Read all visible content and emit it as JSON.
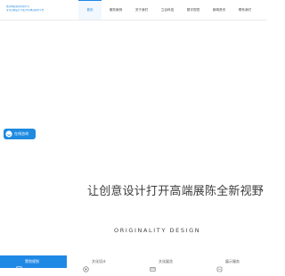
{
  "logo": {
    "line1": "酷派电商策划有限公司",
    "line2": "专业高端设计开发/全程电商服务平台",
    "line3": "",
    "color": "#2f8dde"
  },
  "nav": {
    "items": [
      {
        "label": "首页",
        "active": true
      },
      {
        "label": "服务案例",
        "active": false
      },
      {
        "label": "关于我们",
        "active": false
      },
      {
        "label": "立合科技",
        "active": false
      },
      {
        "label": "数字视觉",
        "active": false
      },
      {
        "label": "新闻资讯",
        "active": false
      },
      {
        "label": "联系我们",
        "active": false
      }
    ]
  },
  "consult_button": {
    "label": "在线咨询",
    "icon": "chat-bubble-icon",
    "color": "#1e8ae0"
  },
  "hero": {
    "slogan": "让创意设计打开高端展陈全新视野",
    "slogan_en": "ORIGINALITY DESIGN"
  },
  "services": [
    {
      "label": "策划规划",
      "icon": "plan-icon",
      "active": true
    },
    {
      "label": "文化设计",
      "icon": "design-icon",
      "active": false
    },
    {
      "label": "文化展览",
      "icon": "exhibit-icon",
      "active": false
    },
    {
      "label": "展示服务",
      "icon": "service-icon",
      "active": false
    }
  ],
  "colors": {
    "accent": "#1e88e5",
    "text": "#3d3d3d"
  }
}
